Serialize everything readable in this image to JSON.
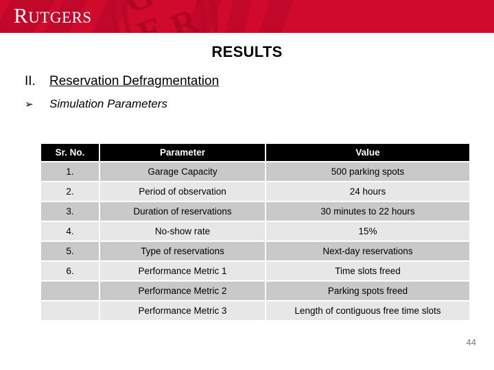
{
  "brand": {
    "logo_text_cap": "R",
    "logo_text_rest": "UTGERS",
    "band_color": "#cf0a2c"
  },
  "slide": {
    "title": "RESULTS",
    "section_marker": "II.",
    "section_title": "Reservation Defragmentation",
    "sub_marker": "➢",
    "sub_title": "Simulation Parameters",
    "page_number": "44"
  },
  "table": {
    "headers": [
      "Sr. No.",
      "Parameter",
      "Value"
    ],
    "rows": [
      {
        "sr": "1.",
        "parameter": "Garage Capacity",
        "value": "500 parking spots"
      },
      {
        "sr": "2.",
        "parameter": "Period of observation",
        "value": "24 hours"
      },
      {
        "sr": "3.",
        "parameter": "Duration of reservations",
        "value": "30 minutes to 22 hours"
      },
      {
        "sr": "4.",
        "parameter": "No-show rate",
        "value": "15%"
      },
      {
        "sr": "5.",
        "parameter": "Type of reservations",
        "value": "Next-day reservations"
      },
      {
        "sr": "6.",
        "parameter": "Performance Metric 1",
        "value": "Time slots freed"
      },
      {
        "sr": "",
        "parameter": "Performance Metric 2",
        "value": "Parking spots freed"
      },
      {
        "sr": "",
        "parameter": "Performance Metric 3",
        "value": "Length of contiguous free time slots"
      }
    ]
  }
}
